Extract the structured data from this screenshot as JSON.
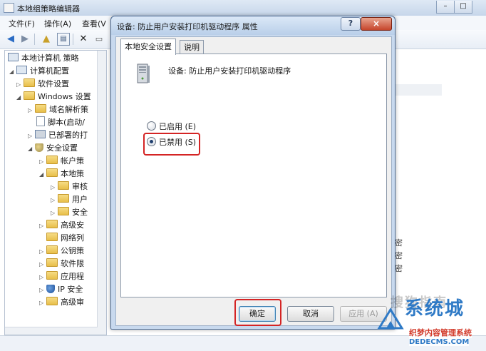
{
  "background_window": {
    "title": "本地组策略编辑器",
    "window_controls": {
      "minimize": "–",
      "maximize": "□"
    },
    "menu": [
      "文件(F)",
      "操作(A)",
      "查看(V"
    ],
    "tree": [
      {
        "label": "本地计算机 策略",
        "indent": 0,
        "icon": "computer-icon",
        "expanded": true
      },
      {
        "label": "计算机配置",
        "indent": 1,
        "icon": "computer-icon",
        "expanded": true
      },
      {
        "label": "软件设置",
        "indent": 2,
        "icon": "folder-icon",
        "expanded": false
      },
      {
        "label": "Windows 设置",
        "indent": 2,
        "icon": "folder-icon",
        "expanded": true
      },
      {
        "label": "域名解析策",
        "indent": 3,
        "icon": "folder-icon",
        "expanded": false
      },
      {
        "label": "脚本(启动/",
        "indent": 3,
        "icon": "document-icon",
        "expanded": null
      },
      {
        "label": "已部署的打",
        "indent": 3,
        "icon": "printer-icon",
        "expanded": false
      },
      {
        "label": "安全设置",
        "indent": 3,
        "icon": "shield-icon",
        "expanded": true
      },
      {
        "label": "帐户策",
        "indent": 4,
        "icon": "folder-icon",
        "expanded": false
      },
      {
        "label": "本地策",
        "indent": 4,
        "icon": "folder-icon",
        "expanded": true
      },
      {
        "label": "审核",
        "indent": 5,
        "icon": "folder-icon",
        "expanded": false
      },
      {
        "label": "用户",
        "indent": 5,
        "icon": "folder-icon",
        "expanded": false
      },
      {
        "label": "安全",
        "indent": 5,
        "icon": "folder-icon",
        "expanded": false
      },
      {
        "label": "高级安",
        "indent": 4,
        "icon": "folder-icon",
        "expanded": false
      },
      {
        "label": "网络列",
        "indent": 4,
        "icon": "folder-icon",
        "expanded": null
      },
      {
        "label": "公钥策",
        "indent": 4,
        "icon": "folder-icon",
        "expanded": false
      },
      {
        "label": "软件限",
        "indent": 4,
        "icon": "folder-icon",
        "expanded": false
      },
      {
        "label": "应用程",
        "indent": 4,
        "icon": "folder-icon",
        "expanded": false
      },
      {
        "label": "IP 安全",
        "indent": 4,
        "icon": "shield-icon",
        "expanded": false
      },
      {
        "label": "高级审",
        "indent": 4,
        "icon": "folder-icon",
        "expanded": false
      }
    ],
    "right_pane_fragments": [
      "密",
      "密",
      "密"
    ]
  },
  "dialog": {
    "title": "设备: 防止用户安装打印机驱动程序 属性",
    "help_button": "?",
    "close_button": "×",
    "tabs": [
      {
        "label": "本地安全设置",
        "active": true
      },
      {
        "label": "说明",
        "active": false
      }
    ],
    "device_label": "设备: 防止用户安装打印机驱动程序",
    "options": [
      {
        "label": "已启用 (E)",
        "checked": false
      },
      {
        "label": "已禁用 (S)",
        "checked": true
      }
    ],
    "buttons": {
      "ok": "确定",
      "cancel": "取消",
      "apply": "应用 (A)"
    },
    "highlight_color": "#d42424"
  },
  "watermarks": {
    "sogou": "搜狗指南",
    "brand": "系统城",
    "sub": "织梦内容管理系统",
    "url": "DEDECMS.COM"
  }
}
